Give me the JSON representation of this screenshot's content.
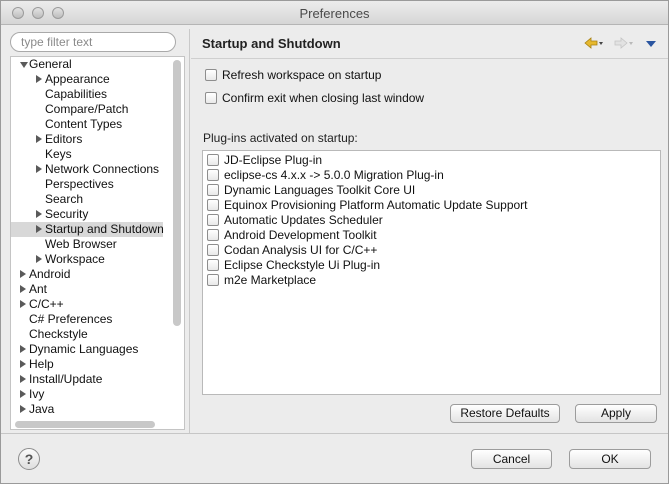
{
  "window": {
    "title": "Preferences"
  },
  "filter": {
    "placeholder": "type filter text",
    "value": ""
  },
  "tree": [
    {
      "label": "General",
      "level": 0,
      "arrow": "down",
      "selected": false
    },
    {
      "label": "Appearance",
      "level": 1,
      "arrow": "right",
      "selected": false
    },
    {
      "label": "Capabilities",
      "level": 1,
      "arrow": "",
      "selected": false
    },
    {
      "label": "Compare/Patch",
      "level": 1,
      "arrow": "",
      "selected": false
    },
    {
      "label": "Content Types",
      "level": 1,
      "arrow": "",
      "selected": false
    },
    {
      "label": "Editors",
      "level": 1,
      "arrow": "right",
      "selected": false
    },
    {
      "label": "Keys",
      "level": 1,
      "arrow": "",
      "selected": false
    },
    {
      "label": "Network Connections",
      "level": 1,
      "arrow": "right",
      "selected": false
    },
    {
      "label": "Perspectives",
      "level": 1,
      "arrow": "",
      "selected": false
    },
    {
      "label": "Search",
      "level": 1,
      "arrow": "",
      "selected": false
    },
    {
      "label": "Security",
      "level": 1,
      "arrow": "right",
      "selected": false
    },
    {
      "label": "Startup and Shutdown",
      "level": 1,
      "arrow": "right",
      "selected": true
    },
    {
      "label": "Web Browser",
      "level": 1,
      "arrow": "",
      "selected": false
    },
    {
      "label": "Workspace",
      "level": 1,
      "arrow": "right",
      "selected": false
    },
    {
      "label": "Android",
      "level": 0,
      "arrow": "right",
      "selected": false
    },
    {
      "label": "Ant",
      "level": 0,
      "arrow": "right",
      "selected": false
    },
    {
      "label": "C/C++",
      "level": 0,
      "arrow": "right",
      "selected": false
    },
    {
      "label": "C# Preferences",
      "level": 0,
      "arrow": "",
      "selected": false
    },
    {
      "label": "Checkstyle",
      "level": 0,
      "arrow": "",
      "selected": false
    },
    {
      "label": "Dynamic Languages",
      "level": 0,
      "arrow": "right",
      "selected": false
    },
    {
      "label": "Help",
      "level": 0,
      "arrow": "right",
      "selected": false
    },
    {
      "label": "Install/Update",
      "level": 0,
      "arrow": "right",
      "selected": false
    },
    {
      "label": "Ivy",
      "level": 0,
      "arrow": "right",
      "selected": false
    },
    {
      "label": "Java",
      "level": 0,
      "arrow": "right",
      "selected": false
    }
  ],
  "page": {
    "title": "Startup and Shutdown",
    "options": [
      {
        "label": "Refresh workspace on startup",
        "checked": false
      },
      {
        "label": "Confirm exit when closing last window",
        "checked": false
      }
    ],
    "plugins_label": "Plug-ins activated on startup:",
    "plugins": [
      {
        "label": "JD-Eclipse Plug-in",
        "checked": false
      },
      {
        "label": "eclipse-cs 4.x.x -> 5.0.0 Migration Plug-in",
        "checked": false
      },
      {
        "label": "Dynamic Languages Toolkit Core UI",
        "checked": false
      },
      {
        "label": "Equinox Provisioning Platform Automatic Update Support",
        "checked": false
      },
      {
        "label": "Automatic Updates Scheduler",
        "checked": false
      },
      {
        "label": "Android Development Toolkit",
        "checked": false
      },
      {
        "label": "Codan Analysis UI for C/C++",
        "checked": false
      },
      {
        "label": "Eclipse Checkstyle Ui Plug-in",
        "checked": false
      },
      {
        "label": "m2e Marketplace",
        "checked": false
      }
    ],
    "restore_label": "Restore Defaults",
    "apply_label": "Apply"
  },
  "footer": {
    "help_label": "?",
    "cancel_label": "Cancel",
    "ok_label": "OK"
  },
  "icons": {
    "back": "back-arrow-icon",
    "forward": "forward-arrow-icon",
    "menu": "view-menu-icon",
    "help": "help-icon"
  },
  "colors": {
    "back_arrow": "#e6b82e",
    "menu_arrow": "#2a55a0",
    "selection": "#d8d8d8"
  }
}
